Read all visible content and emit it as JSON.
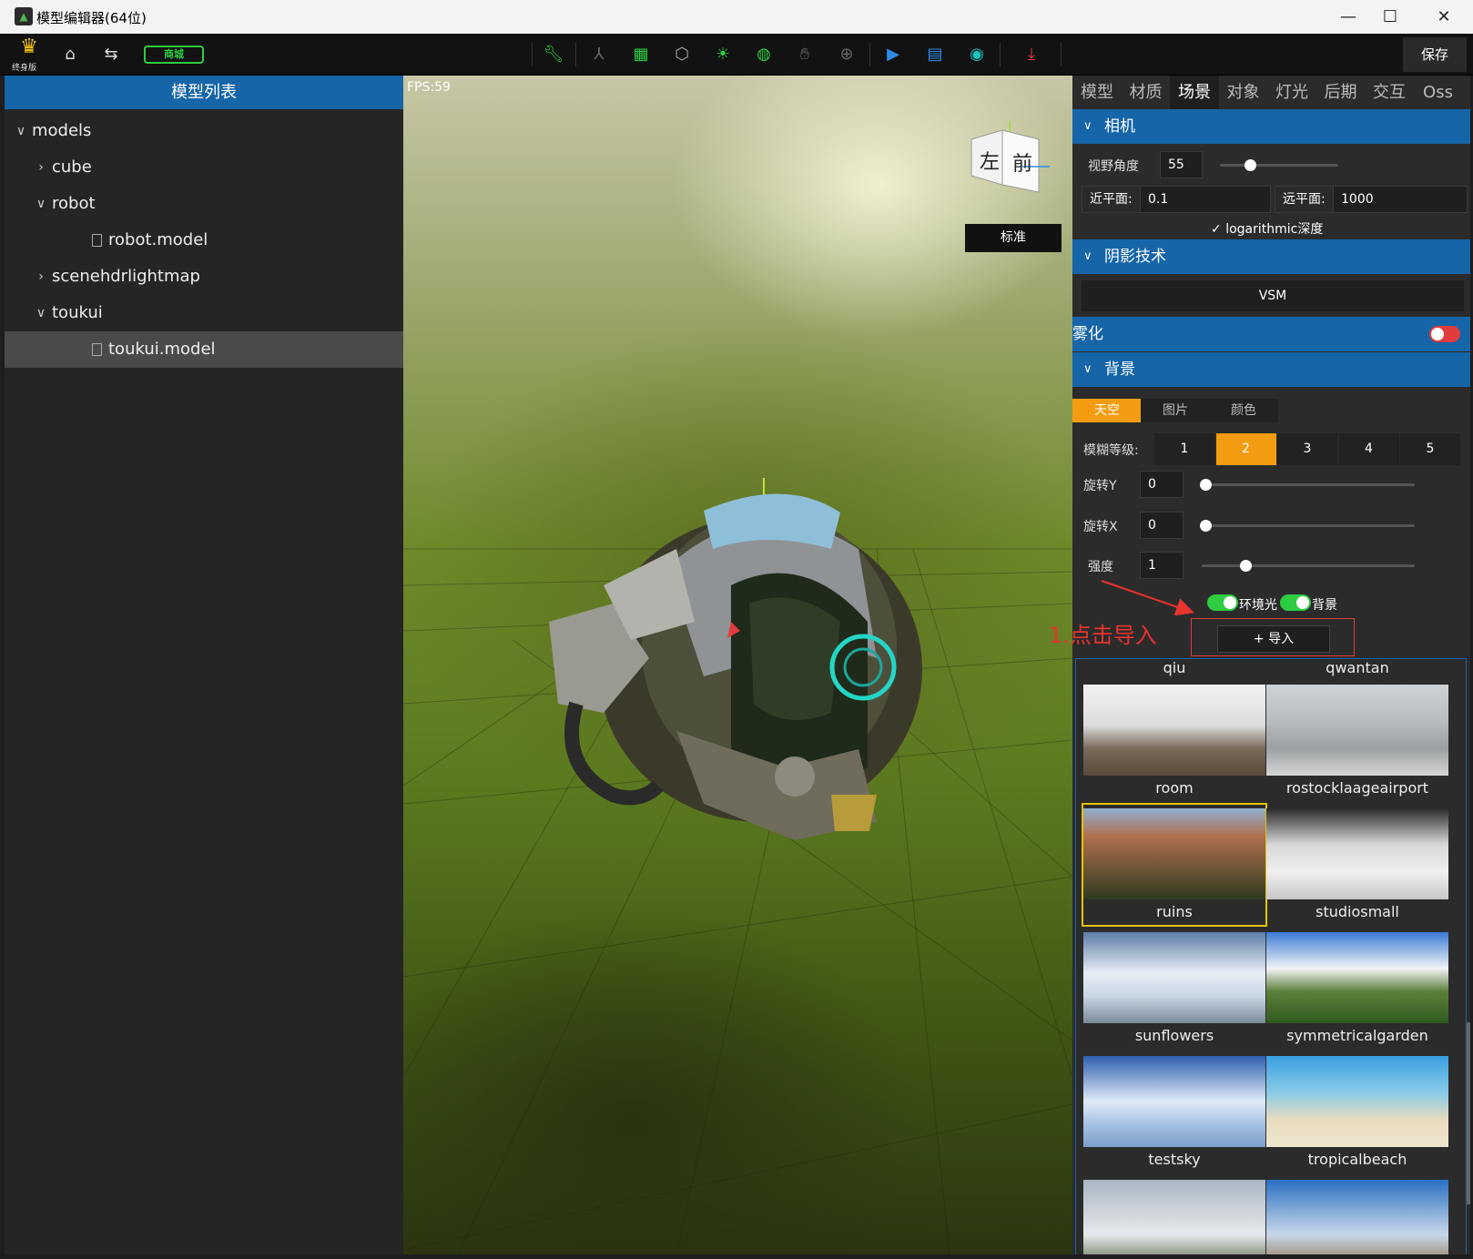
{
  "window": {
    "title": "模型编辑器(64位)"
  },
  "toolbar": {
    "crown_label": "终身版",
    "shop_label": "商城",
    "save_label": "保存"
  },
  "left_panel": {
    "header": "模型列表",
    "tree": [
      {
        "label": "models",
        "level": 0,
        "expanded": true,
        "type": "folder"
      },
      {
        "label": "cube",
        "level": 1,
        "expanded": false,
        "type": "folder"
      },
      {
        "label": "robot",
        "level": 1,
        "expanded": true,
        "type": "folder"
      },
      {
        "label": "robot.model",
        "level": 2,
        "type": "file"
      },
      {
        "label": "scenehdrlightmap",
        "level": 1,
        "expanded": false,
        "type": "folder"
      },
      {
        "label": "toukui",
        "level": 1,
        "expanded": true,
        "type": "folder"
      },
      {
        "label": "toukui.model",
        "level": 2,
        "type": "file",
        "selected": true
      }
    ]
  },
  "viewport": {
    "fps": "FPS:59",
    "view_button": "标准",
    "cube_faces": {
      "left": "左",
      "front": "前"
    }
  },
  "right_panel": {
    "tabs": [
      "模型",
      "材质",
      "场景",
      "对象",
      "灯光",
      "后期",
      "交互",
      "Oss"
    ],
    "active_tab": "场景",
    "camera": {
      "header": "相机",
      "fov_label": "视野角度",
      "fov_value": "55",
      "fov_fraction": 0.25,
      "near_label": "近平面:",
      "near_value": "0.1",
      "far_label": "远平面:",
      "far_value": "1000",
      "log_depth_label": "logarithmic深度",
      "log_depth_checked": true
    },
    "shadow": {
      "header": "阴影技术",
      "value": "VSM"
    },
    "fog": {
      "label": "雾化",
      "enabled": false
    },
    "background": {
      "header": "背景",
      "tabs": [
        "天空",
        "图片",
        "颜色"
      ],
      "active_tab": "天空",
      "blur_label": "模糊等级:",
      "blur_levels": [
        "1",
        "2",
        "3",
        "4",
        "5"
      ],
      "blur_active": "2",
      "rot_y_label": "旋转Y",
      "rot_y_value": "0",
      "rot_x_label": "旋转X",
      "rot_x_value": "0",
      "intensity_label": "强度",
      "intensity_value": "1",
      "ambient_label": "环境光",
      "ambient_on": true,
      "bg_label": "背景",
      "bg_on": true,
      "import_label": "+ 导入",
      "callout": "1.点击导入",
      "skies": [
        {
          "name": "qiu"
        },
        {
          "name": "qwantan"
        },
        {
          "name": "room"
        },
        {
          "name": "rostocklaageairport"
        },
        {
          "name": "ruins",
          "selected": true
        },
        {
          "name": "studiosmall"
        },
        {
          "name": "sunflowers"
        },
        {
          "name": "symmetricalgarden"
        },
        {
          "name": "testsky"
        },
        {
          "name": "tropicalbeach"
        }
      ]
    }
  },
  "colors": {
    "accent_blue": "#1565a8",
    "accent_orange": "#f39c12",
    "toggle_green": "#2ecc40",
    "toggle_red": "#e23b3b",
    "callout_red": "#e8332e"
  }
}
